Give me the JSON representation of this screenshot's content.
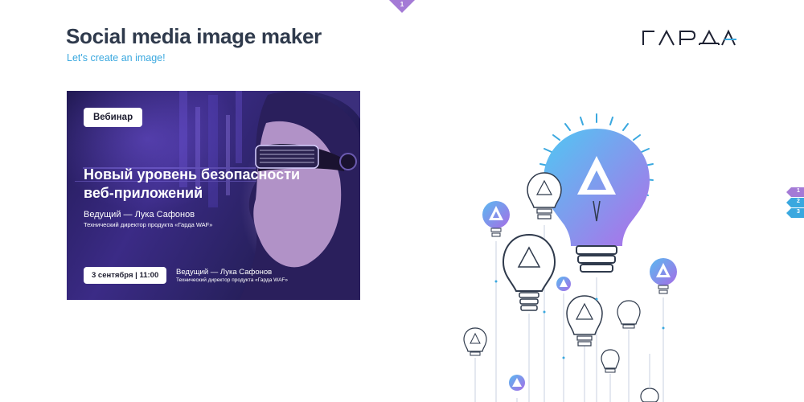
{
  "top_marker": {
    "label": "1",
    "color": "#a47ad6"
  },
  "header": {
    "title": "Social media image maker",
    "subtitle": "Let's create an image!"
  },
  "logo": {
    "text": "ГАРДА",
    "icon": "garda-logo"
  },
  "preview": {
    "badge": "Вебинар",
    "headline_line1": "Новый уровень безопасности",
    "headline_line2": "веб-приложений",
    "host": "Ведущий — Лука Сафонов",
    "role": "Технический директор продукта «Гарда WAF»",
    "date_badge": "3 сентября | 11:00",
    "host_footer": "Ведущий — Лука Сафонов",
    "role_footer": "Технический директор продукта «Гарда WAF»"
  },
  "illustration": {
    "icon": "lightbulbs-illustration"
  },
  "side_nav": {
    "tabs": [
      {
        "label": "1",
        "color": "#a47ad6"
      },
      {
        "label": "2",
        "color": "#3aa8df"
      },
      {
        "label": "3",
        "color": "#3aa8df"
      }
    ]
  }
}
